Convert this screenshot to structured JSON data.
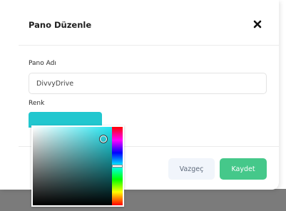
{
  "dialog": {
    "title": "Pano Düzenle",
    "close_icon": "close-icon"
  },
  "form": {
    "name": {
      "label": "Pano Adı",
      "value": "DivvyDrive"
    },
    "color": {
      "label": "Renk",
      "value": "#21c7cf"
    }
  },
  "color_picker": {
    "hue_color": "#21e4f0",
    "hue_level_percent": 50,
    "saturation_percent": 86,
    "brightness_percent": 86
  },
  "actions": {
    "cancel_label": "Vazgeç",
    "save_label": "Kaydet"
  },
  "colors": {
    "accent_save": "#45c88a",
    "cancel_bg": "#f1f5fb",
    "cancel_text": "#5f6b7c"
  }
}
